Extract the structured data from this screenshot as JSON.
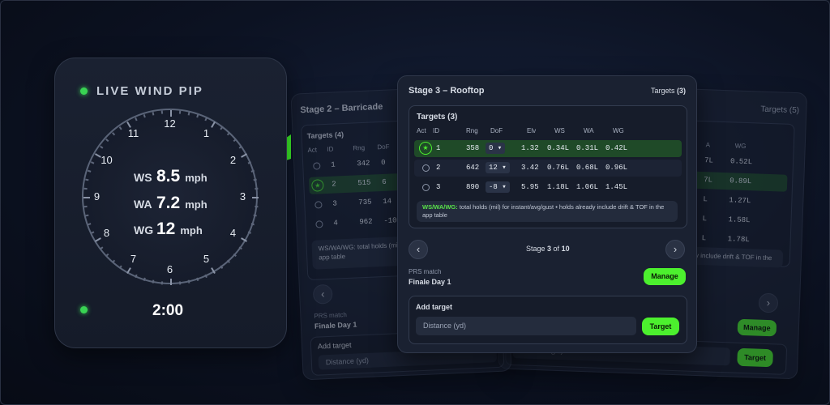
{
  "watch": {
    "title": "LIVE WIND PIP",
    "timer": "2:00",
    "dial_numbers": [
      "12",
      "1",
      "2",
      "3",
      "4",
      "5",
      "6",
      "7",
      "8",
      "9",
      "10",
      "11"
    ],
    "readings": [
      {
        "key": "WS",
        "value": "8.5",
        "unit": "mph"
      },
      {
        "key": "WA",
        "value": "7.2",
        "unit": "mph"
      },
      {
        "key": "WG",
        "value": "12",
        "unit": "mph"
      }
    ],
    "accent": "#39d353"
  },
  "left_card": {
    "title": "Stage 2 – Barricade",
    "targets_title": "Targets (4)",
    "headers": [
      "Act",
      "ID",
      "Rng",
      "DoF"
    ],
    "rows": [
      {
        "id": "1",
        "rng": "342",
        "dof": "0"
      },
      {
        "id": "2",
        "rng": "515",
        "dof": "6"
      },
      {
        "id": "3",
        "rng": "735",
        "dof": "14"
      },
      {
        "id": "4",
        "rng": "962",
        "dof": "-10"
      }
    ],
    "note": "WS/WA/WG: total holds (mi app table",
    "match_label": "PRS match",
    "match_name": "Finale Day 1",
    "add_target": "Add target",
    "distance_placeholder": "Distance (yd)"
  },
  "right_card": {
    "targets_count": "Targets (5)",
    "col_wa": "A",
    "col_wg": "WG",
    "rows": [
      {
        "wa": "7L",
        "wg": "0.52L"
      },
      {
        "wa": "7L",
        "wg": "0.89L"
      },
      {
        "wa": "L",
        "wg": "1.27L"
      },
      {
        "wa": "L",
        "wg": "1.58L"
      },
      {
        "wa": "L",
        "wg": "1.78L"
      }
    ],
    "note": "y include drift & TOF in the",
    "manage": "Manage",
    "distance_placeholder": "Distance (yd)",
    "target_button": "Target"
  },
  "main_card": {
    "title": "Stage 3 – Rooftop",
    "targets_header": "Targets",
    "targets_count": "(3)",
    "targets_title": "Targets (3)",
    "headers": [
      "Act",
      "ID",
      "Rng",
      "DoF",
      "Elv",
      "WS",
      "WA",
      "WG"
    ],
    "rows": [
      {
        "id": "1",
        "rng": "358",
        "dof": "0",
        "elv": "1.32",
        "ws": "0.34L",
        "wa": "0.31L",
        "wg": "0.42L",
        "active": true
      },
      {
        "id": "2",
        "rng": "642",
        "dof": "12",
        "elv": "3.42",
        "ws": "0.76L",
        "wa": "0.68L",
        "wg": "0.96L",
        "active": false
      },
      {
        "id": "3",
        "rng": "890",
        "dof": "-8",
        "elv": "5.95",
        "ws": "1.18L",
        "wa": "1.06L",
        "wg": "1.45L",
        "active": false
      }
    ],
    "note_bold": "WS/WA/WG:",
    "note_text": " total holds (mil) for instant/avg/gust • holds already include drift & TOF in the app table",
    "stage_prefix": "Stage ",
    "stage_current": "3",
    "stage_of": " of ",
    "stage_total": "10",
    "match_label": "PRS match",
    "match_name": "Finale Day 1",
    "manage": "Manage",
    "add_target": "Add target",
    "distance_placeholder": "Distance (yd)",
    "target_button": "Target"
  }
}
